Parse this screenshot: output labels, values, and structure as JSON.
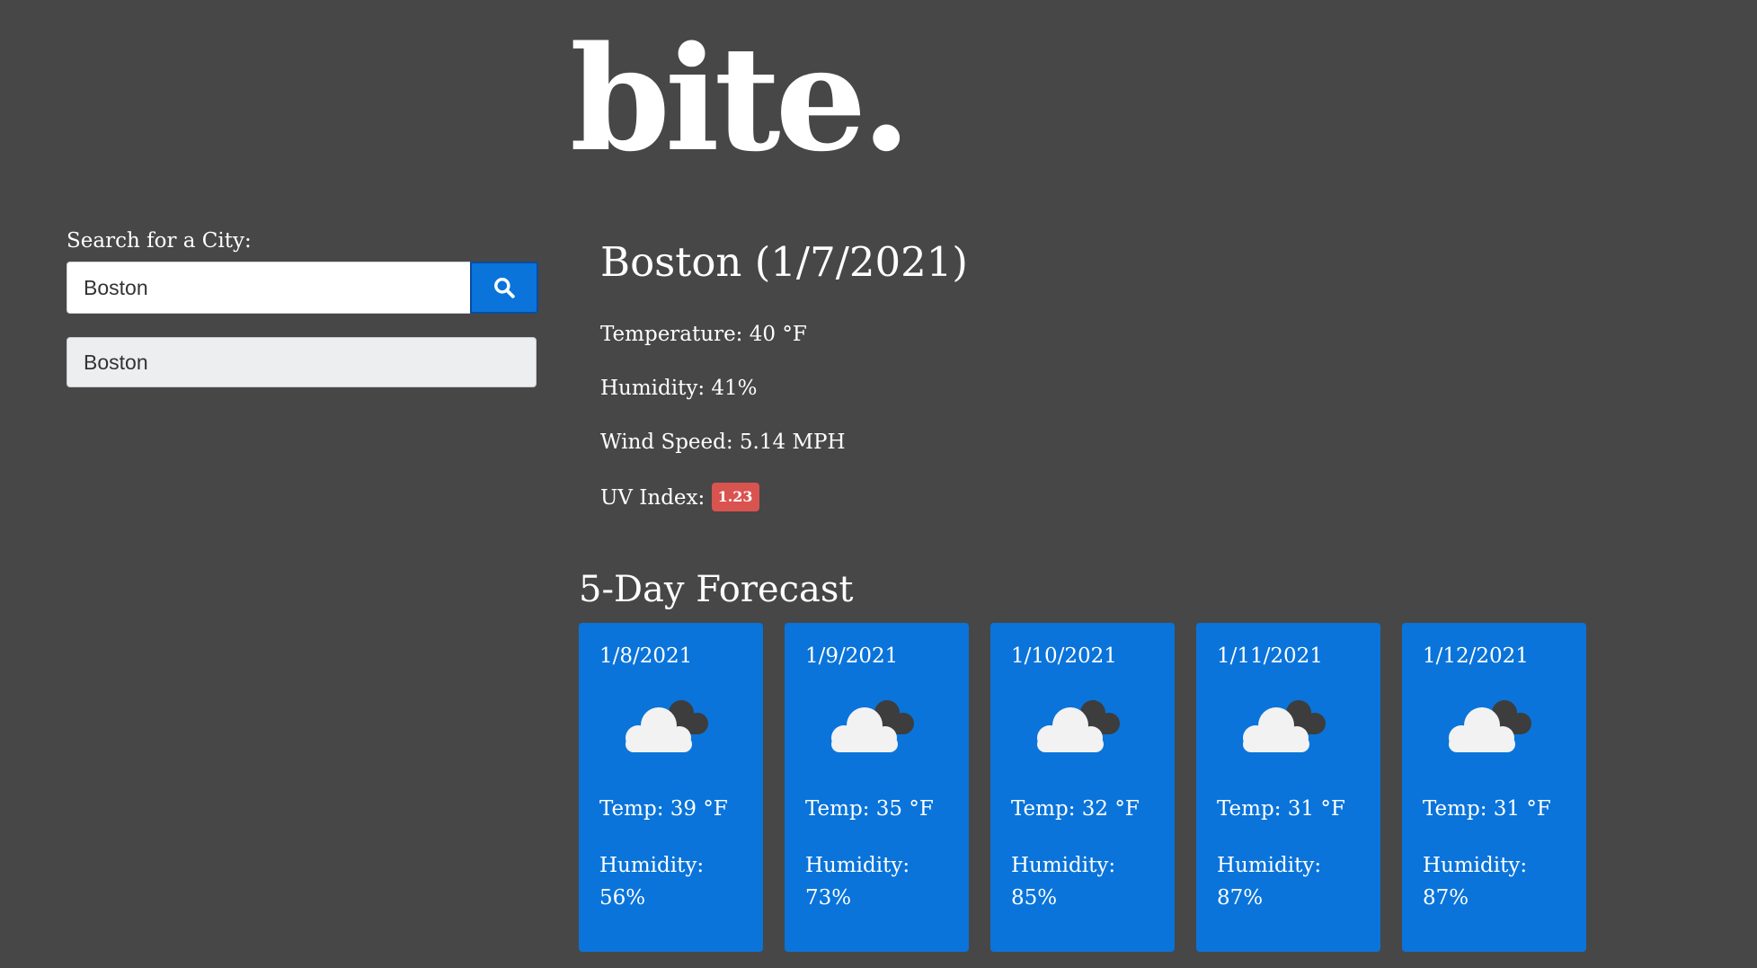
{
  "header": {
    "brand": "bite."
  },
  "sidebar": {
    "search_label": "Search for a City:",
    "search_value": "Boston",
    "search_icon": "search-icon",
    "history": [
      {
        "label": "Boston"
      }
    ]
  },
  "current": {
    "title": "Boston (1/7/2021)",
    "temperature": "Temperature: 40 °F",
    "humidity": "Humidity: 41%",
    "wind": "Wind Speed: 5.14 MPH",
    "uv_label": "UV Index:",
    "uv_value": "1.23",
    "uv_color": "#d9534f"
  },
  "forecast": {
    "title": "5-Day Forecast",
    "card_color": "#0a74da",
    "days": [
      {
        "date": "1/8/2021",
        "icon": "broken-clouds-icon",
        "temp": "Temp: 39 °F",
        "humidity": "Humidity: 56%"
      },
      {
        "date": "1/9/2021",
        "icon": "broken-clouds-icon",
        "temp": "Temp: 35 °F",
        "humidity": "Humidity: 73%"
      },
      {
        "date": "1/10/2021",
        "icon": "broken-clouds-icon",
        "temp": "Temp: 32 °F",
        "humidity": "Humidity: 85%"
      },
      {
        "date": "1/11/2021",
        "icon": "broken-clouds-icon",
        "temp": "Temp: 31 °F",
        "humidity": "Humidity: 87%"
      },
      {
        "date": "1/12/2021",
        "icon": "broken-clouds-icon",
        "temp": "Temp: 31 °F",
        "humidity": "Humidity: 87%"
      }
    ]
  }
}
